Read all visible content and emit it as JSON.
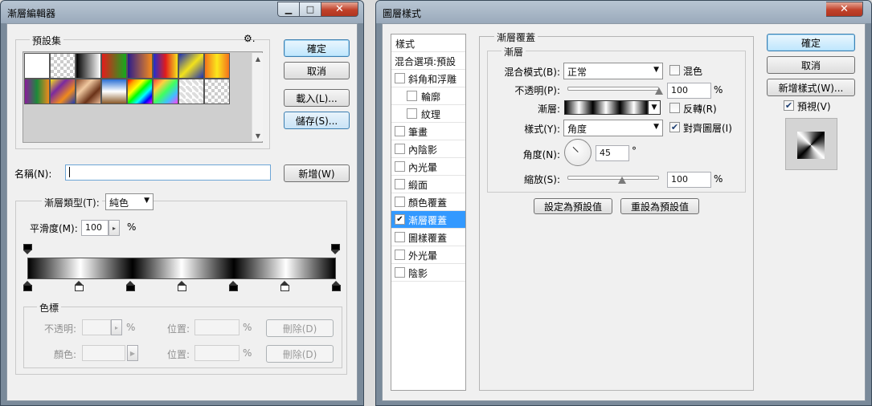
{
  "gradient_editor": {
    "title": "漸層編輯器",
    "presets_label": "預設集",
    "buttons": {
      "ok": "確定",
      "cancel": "取消",
      "load": "載入(L)...",
      "save": "儲存(S)...",
      "new": "新增(W)"
    },
    "name_label": "名稱(N):",
    "name_value": "",
    "gradient_type_label": "漸層類型(T):",
    "gradient_type_value": "純色",
    "smoothness_label": "平滑度(M):",
    "smoothness_value": "100",
    "percent": "%",
    "color_stops": {
      "title": "色標",
      "opacity_label": "不透明:",
      "color_label": "顏色:",
      "location_label": "位置:",
      "delete_label": "刪除(D)"
    },
    "preset_count": 16,
    "opacity_stops": [
      "#000000",
      "#000000"
    ],
    "color_stop_colors": [
      "#000000",
      "#ffffff",
      "#000000",
      "#ffffff",
      "#000000",
      "#ffffff",
      "#000000"
    ]
  },
  "layer_style": {
    "title": "圖層樣式",
    "styles_header": "樣式",
    "blending_options": "混合選項:預設",
    "style_items": [
      {
        "label": "斜角和浮雕",
        "checked": false,
        "indent": false
      },
      {
        "label": "輪廓",
        "checked": false,
        "indent": true
      },
      {
        "label": "紋理",
        "checked": false,
        "indent": true
      },
      {
        "label": "筆畫",
        "checked": false,
        "indent": false
      },
      {
        "label": "內陰影",
        "checked": false,
        "indent": false
      },
      {
        "label": "內光暈",
        "checked": false,
        "indent": false
      },
      {
        "label": "緞面",
        "checked": false,
        "indent": false
      },
      {
        "label": "顏色覆蓋",
        "checked": false,
        "indent": false
      },
      {
        "label": "漸層覆蓋",
        "checked": true,
        "indent": false
      },
      {
        "label": "圖樣覆蓋",
        "checked": false,
        "indent": false
      },
      {
        "label": "外光暈",
        "checked": false,
        "indent": false
      },
      {
        "label": "陰影",
        "checked": false,
        "indent": false
      }
    ],
    "section_title": "漸層覆蓋",
    "subsection_title": "漸層",
    "blend_mode_label": "混合模式(B):",
    "blend_mode_value": "正常",
    "dither_label": "混色",
    "dither_checked": false,
    "opacity_label": "不透明(P):",
    "opacity_value": "100",
    "gradient_label": "漸層:",
    "reverse_label": "反轉(R)",
    "reverse_checked": false,
    "style_label": "樣式(Y):",
    "style_value": "角度",
    "align_label": "對齊圖層(I)",
    "align_checked": true,
    "angle_label": "角度(N):",
    "angle_value": "45",
    "degree": "°",
    "scale_label": "縮放(S):",
    "scale_value": "100",
    "percent": "%",
    "opacity_level": 1.0,
    "scale_level": 0.6,
    "set_default": "設定為預設值",
    "reset_default": "重設為預設值",
    "buttons": {
      "ok": "確定",
      "cancel": "取消",
      "new_style": "新增樣式(W)..."
    },
    "preview_label": "預視(V)",
    "preview_checked": true
  }
}
